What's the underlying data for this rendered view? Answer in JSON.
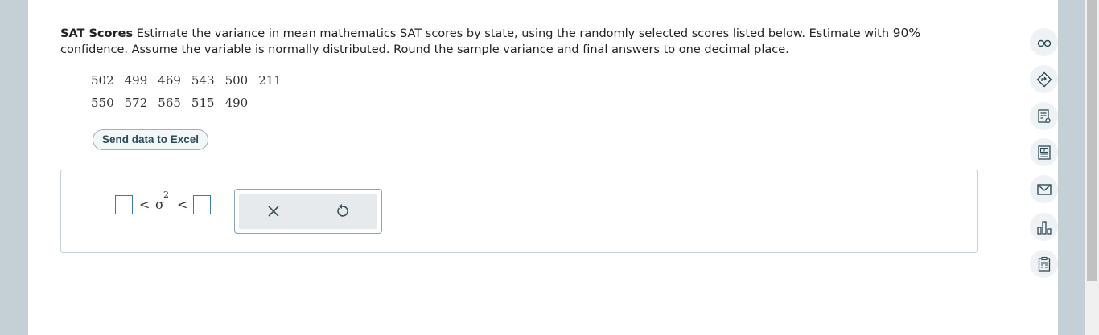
{
  "question": {
    "title": "SAT Scores",
    "text_before_pct": " Estimate the variance in mean mathematics SAT scores by state, using the randomly selected scores listed below. Estimate with ",
    "confidence": "90%",
    "text_after_pct": " confidence. Assume the variable is normally distributed. Round the sample variance and final answers to one decimal place."
  },
  "data": {
    "row1": [
      "502",
      "499",
      "469",
      "543",
      "500",
      "211"
    ],
    "row2": [
      "550",
      "572",
      "565",
      "515",
      "490"
    ]
  },
  "excel_button": "Send data to Excel",
  "answer": {
    "lt1": "<",
    "sigma": "σ",
    "exponent": "2",
    "lt2": "<"
  },
  "tools": {
    "clear": "×",
    "undo": "↺"
  },
  "side_icons": [
    "glasses-icon",
    "directions-icon",
    "notes-icon",
    "calculator-icon",
    "mail-icon",
    "chart-icon",
    "clipboard-icon"
  ],
  "colors": {
    "accent": "#3a7ca5",
    "background": "#c5d0d6"
  }
}
